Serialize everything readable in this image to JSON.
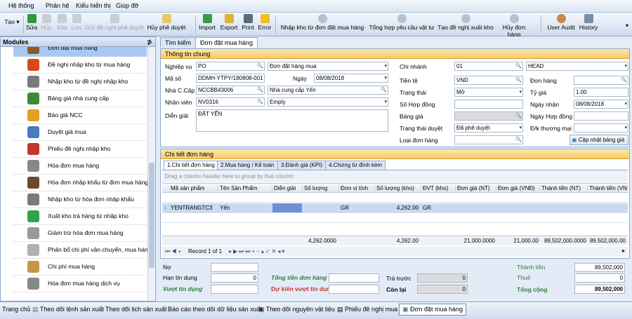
{
  "menu": [
    "Hệ thống",
    "Phân hệ",
    "Kiểu hiển thị",
    "Giúp đỡ"
  ],
  "toolbar": {
    "new": "Tạo",
    "edit": "Sửa",
    "cancel": "Hủy",
    "delete": "Xóa",
    "save": "Lưu",
    "send_approval": "Gửi đề nghị phê duyệt",
    "cancel_approval": "Hủy phê duyệt",
    "import": "Import",
    "export": "Export",
    "print": "Print",
    "error": "Error",
    "import_po": "Nhập kho từ đơn đặt mua hàng",
    "summary_supplies": "Tổng hợp yêu cầu vật tư",
    "request_export": "Tạo đề nghị xuất kho",
    "cancel_order": "Hủy đơn hàng",
    "user_audit": "User Audit",
    "history": "History"
  },
  "modules": {
    "title": "Modules",
    "pin": "⊅",
    "items": [
      {
        "label": "Đơn đặt mua hàng",
        "icon": "order-book-icon",
        "color": "#8a5a2b"
      },
      {
        "label": "Đề nghị nhập kho từ mua hàng",
        "icon": "target-icon",
        "color": "#d84a1b"
      },
      {
        "label": "Nhập kho từ đề nghị nhập kho",
        "icon": "tools-icon",
        "color": "#7a7a7a"
      },
      {
        "label": "Bảng giá nhà cung cấp",
        "icon": "price-list-icon",
        "color": "#3b8a3b"
      },
      {
        "label": "Báo giá NCC",
        "icon": "palette-icon",
        "color": "#e0a020"
      },
      {
        "label": "Duyệt giá mua",
        "icon": "approve-price-icon",
        "color": "#4a7ac0"
      },
      {
        "label": "Phiếu đề nghị nhập kho",
        "icon": "toolbox-icon",
        "color": "#c0392b"
      },
      {
        "label": "Hóa đơn mua hàng",
        "icon": "invoice-icon",
        "color": "#888888"
      },
      {
        "label": "Hóa đơn nhập khẩu từ đơn mua hàng",
        "icon": "import-invoice-icon",
        "color": "#6b4a2b"
      },
      {
        "label": "Nhập kho từ hóa đơn nhập khẩu",
        "icon": "warehouse-icon",
        "color": "#7a7a7a"
      },
      {
        "label": "Xuất kho trả hàng từ nhập kho",
        "icon": "check-icon",
        "color": "#2ea44f"
      },
      {
        "label": "Giảm trừ hóa đơn mua hàng",
        "icon": "discount-icon",
        "color": "#999999"
      },
      {
        "label": "Phân bổ chi phí vận chuyển, mua hàng...",
        "icon": "allocate-icon",
        "color": "#b0b0b0"
      },
      {
        "label": "Chi phí mua hàng",
        "icon": "box-icon",
        "color": "#c9934a"
      },
      {
        "label": "Hóa đơn mua hàng dịch vụ",
        "icon": "service-invoice-icon",
        "color": "#888888"
      }
    ]
  },
  "tabs": [
    "Tìm kiếm",
    "Đơn đặt mua hàng"
  ],
  "general": {
    "title": "Thông tin chung",
    "business_label": "Nghiệp vụ",
    "business_value": "PO",
    "business_desc": "Đơn đặt hàng mua",
    "code_label": "Mã số",
    "code_value": "DDMH-YTPY/180808-001",
    "date_label": "Ngày",
    "date_value": "08/08/2018",
    "supplier_label": "Nhà C.Cấp",
    "supplier_code": "NCCBB43006",
    "supplier_name": "Nhà cung cấp Yến",
    "staff_label": "Nhân viên",
    "staff_code": "NV0316",
    "staff_name": "Empty",
    "note_label": "Diễn giải",
    "note_value": "ĐẶT YẾN",
    "branch_label": "Chi nhánh",
    "branch_value": "01",
    "branch_name": "HEAD",
    "currency_label": "Tiền tệ",
    "currency_value": "VND",
    "order_label": "Đơn hàng",
    "status_label": "Trạng thái",
    "status_value": "Mở",
    "rate_label": "Tỷ giá",
    "rate_value": "1.00",
    "contract_label": "Số Hợp đồng",
    "receive_label": "Ngày nhận",
    "receive_value": "08/08/2018",
    "price_list_label": "Bảng giá",
    "contract_date_label": "Ngày Hợp đồng",
    "approval_label": "Trạng thái duyệt",
    "approval_value": "Đã phê duyệt",
    "trade_label": "Đ/k thương mại",
    "order_type_label": "Loại đơn hàng",
    "update_price_btn": "Cập nhật bảng giá"
  },
  "detail": {
    "title": "Chi tiết đơn hàng",
    "subtabs": [
      "1.Chi tiết đơn hàng",
      "2.Mua hàng / Kế toán",
      "3.Đánh giá (KPI)",
      "4.Chứng từ đính kèm"
    ],
    "group_hint": "Drag a column header here to group by that column",
    "columns": [
      "Mã sản phẩm",
      "Tên Sản Phẩm",
      "Diễn giải",
      "Số lượng",
      "Đơn vị tính",
      "Số lượng (kho)",
      "ĐVT (kho)",
      "Đơn giá (NT)",
      "Đơn giá (VNĐ)",
      "Thành tiền (NT)",
      "Thành tiền (VNĐ)"
    ],
    "row": {
      "code": "YENTRANGTC3",
      "name": "Yến",
      "unit": "GR",
      "qty_stock": "4,262.00",
      "unit_stock": "GR"
    },
    "totals": {
      "qty": "4,262.0000",
      "qty_stock": "4,262.00",
      "price_nt": "21,000.0000",
      "price_vnd": "21,000.00",
      "amount_nt": "89,502,000.0000",
      "amount_vnd": "89,502,000.00"
    },
    "nav_record": "Record 1 of 1"
  },
  "footer": {
    "debt_label": "Nợ",
    "credit_limit_label": "Hạn tín dụng",
    "credit_limit_value": "0",
    "over_credit_label": "Vượt tín dụng",
    "total_order_label": "Tổng tiền đơn hàng",
    "est_over_label": "Dự kiến vượt tín dụng",
    "prepaid_label": "Trả trước",
    "prepaid_value": "0",
    "remaining_label": "Còn lại",
    "remaining_value": "0",
    "amount_label": "Thành tiền",
    "amount_value": "89,502,000",
    "tax_label": "Thuế",
    "tax_value": "0",
    "grand_total_label": "Tổng cộng",
    "grand_total_value": "89,502,000"
  },
  "statusbar": [
    "Trang chủ",
    "Theo dõi lệnh sản xuất",
    "Theo dõi lịch sản xuất",
    "Báo cáo theo dõi dữ liệu sản xuất",
    "Theo dõi nguyên vật liệu",
    "Phiếu đề nghị mua",
    "Đơn đặt mua hàng"
  ]
}
